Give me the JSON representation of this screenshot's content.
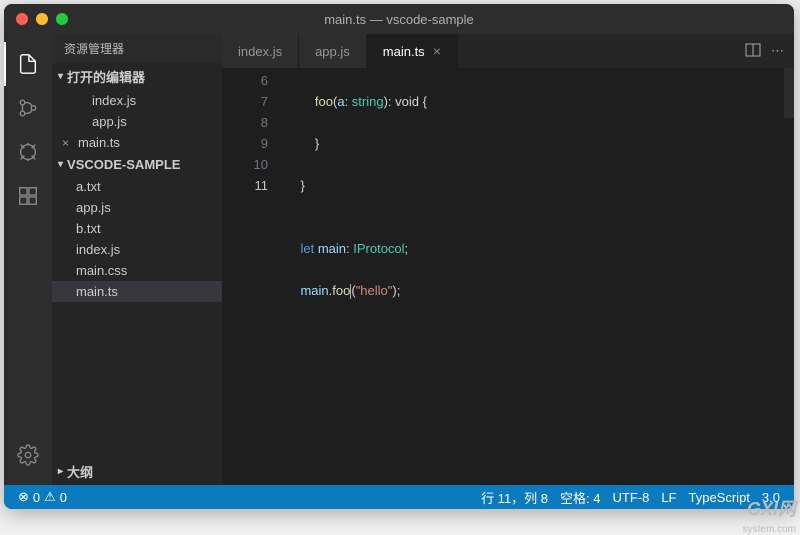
{
  "window": {
    "title": "main.ts — vscode-sample"
  },
  "sidebar": {
    "title": "资源管理器",
    "sections": {
      "openEditors": {
        "label": "打开的编辑器",
        "files": [
          {
            "name": "index.js",
            "modified": false
          },
          {
            "name": "app.js",
            "modified": false
          },
          {
            "name": "main.ts",
            "modified": true
          }
        ]
      },
      "folder": {
        "label": "VSCODE-SAMPLE",
        "files": [
          {
            "name": "a.txt"
          },
          {
            "name": "app.js"
          },
          {
            "name": "b.txt"
          },
          {
            "name": "index.js"
          },
          {
            "name": "main.css"
          },
          {
            "name": "main.ts",
            "selected": true
          }
        ]
      },
      "outline": {
        "label": "大纲"
      }
    }
  },
  "tabs": [
    {
      "label": "index.js",
      "active": false
    },
    {
      "label": "app.js",
      "active": false
    },
    {
      "label": "main.ts",
      "active": true
    }
  ],
  "code": {
    "lines": [
      6,
      7,
      8,
      9,
      10,
      11
    ],
    "l6": {
      "indent": "        ",
      "fn": "foo",
      "paren": "(",
      "param": "a",
      "colon": ": ",
      "type": "string",
      "rest": "): void {"
    },
    "l7": "        }",
    "l8": "    }",
    "l9": "",
    "l10": {
      "indent": "    ",
      "let": "let",
      "sp": " ",
      "var": "main",
      "colon": ": ",
      "type": "IProtocol",
      "semi": ";"
    },
    "l11": {
      "indent": "    ",
      "obj": "main",
      "dot": ".",
      "fn": "foo",
      "open": "(",
      "str": "\"hello\"",
      "close": ");"
    }
  },
  "statusbar": {
    "errors": "0",
    "warnings": "0",
    "cursor": "行 11，列 8",
    "spaces": "空格: 4",
    "encoding": "UTF-8",
    "eol": "LF",
    "lang": "TypeScript",
    "version": "3.0"
  },
  "watermark": {
    "line1": "GXI网",
    "line2": "system.com"
  }
}
